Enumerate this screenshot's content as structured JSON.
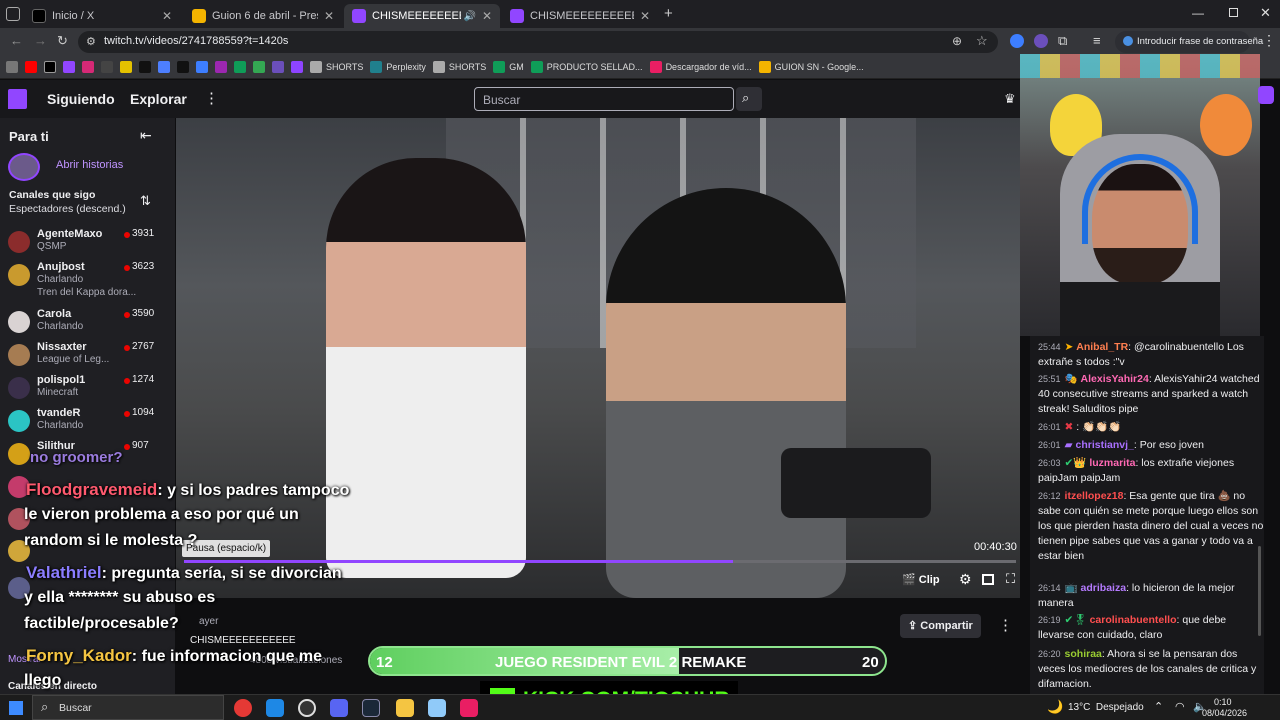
{
  "tabs": [
    {
      "label": "Inicio / X"
    },
    {
      "label": "Guion 6 de abril - Presentacion"
    },
    {
      "label": "CHISMEEEEEEEEEE - Twitch"
    },
    {
      "label": "CHISMEEEEEEEEEE - Twitch"
    }
  ],
  "address": {
    "url": "twitch.tv/videos/2741788559?t=1420s",
    "password_hint": "Introducir frase de contraseña"
  },
  "bookmarks": [
    "SHORTS",
    "Perplexity",
    "SHORTS",
    "GM",
    "PRODUCTO SELLAD...",
    "Descargador de víd...",
    "GUION SN - Google..."
  ],
  "nav": {
    "following": "Siguiendo",
    "explore": "Explorar",
    "search_placeholder": "Buscar"
  },
  "sidebar": {
    "for_you": "Para ti",
    "open_stories": "Abrir historias",
    "followed_title": "Canales que sigo",
    "sort": "Espectadores (descend.)",
    "channels": [
      {
        "name": "AgenteMaxo",
        "game": "QSMP",
        "viewers": "3931"
      },
      {
        "name": "Anujbost",
        "game": "Charlando",
        "extra": "Tren del Kappa dora...",
        "viewers": "3623"
      },
      {
        "name": "Carola",
        "game": "Charlando",
        "viewers": "3590"
      },
      {
        "name": "Nissaxter",
        "game": "League of Leg...",
        "viewers": "2767"
      },
      {
        "name": "polispol1",
        "game": "Minecraft",
        "viewers": "1274"
      },
      {
        "name": "tvandeR",
        "game": "Charlando",
        "viewers": "1094"
      },
      {
        "name": "Silithur",
        "game": "",
        "viewers": "907"
      }
    ],
    "show_more": "Mostrar",
    "live_channels": "Canales en directo"
  },
  "player": {
    "pause_tooltip": "Pausa (espacio/k)",
    "time": "00:40:30",
    "clip": "Clip",
    "share": "Compartir",
    "date": "ayer",
    "title": "CHISMEEEEEEEEEEE",
    "views": "4808 visualizaciones",
    "progress": 0.66
  },
  "overlay_chat": [
    {
      "user": "Floodgravemeid",
      "text": ": y si los padres tampoco"
    },
    {
      "user": "",
      "text": "le vieron problema a eso por qué un"
    },
    {
      "user": "",
      "text": "random si le molesta ?"
    },
    {
      "user": "Valathriel",
      "text": ": pregunta sería, si se divorcian"
    },
    {
      "user": "",
      "text": "y ella ******** su abuso es"
    },
    {
      "user": "",
      "text": "factible/procesable?"
    },
    {
      "user": "Forny_Kador",
      "text": ": fue informacion que me"
    },
    {
      "user": "",
      "text": "llego"
    }
  ],
  "overlay_top": "no groomer?",
  "goal": {
    "left": "12",
    "label": "JUEGO RESIDENT EVIL 2 REMAKE",
    "right": "20",
    "fill": 0.6
  },
  "kick": {
    "label": "KICK.COM/TIOSHUR"
  },
  "chat": [
    {
      "time": "25:44",
      "user": "Anibal_TR",
      "msg": ": @carolinabuentello Los extrañe s todos :\"v",
      "color": "#ff7f50"
    },
    {
      "time": "25:51",
      "user": "AlexisYahir24",
      "msg": ": AlexisYahir24 watched 40 consecutive streams and sparked a watch streak! Saluditos pipe",
      "color": "#ff69b4"
    },
    {
      "time": "26:01",
      "user": "",
      "msg": ": 👏🏻👏🏻👏🏻",
      "color": "#5b5bff"
    },
    {
      "time": "26:01",
      "user": "christianvj_",
      "msg": ": Por eso joven",
      "color": "#a970ff"
    },
    {
      "time": "26:03",
      "user": "luzmarita",
      "msg": ": los extrañe viejones paipJam paipJam",
      "color": "#ff69b4"
    },
    {
      "time": "26:12",
      "user": "itzellopez18",
      "msg": ": Esa gente que tira 💩 no sabe con quién se mete porque luego ellos son los que pierden hasta dinero del cual a veces no tienen pipe sabes que vas a ganar y todo va a estar bien",
      "color": "#ff4f4f"
    },
    {
      "time": "26:14",
      "user": "adribaiza",
      "msg": ": lo hicieron de la mejor manera",
      "color": "#b57bff"
    },
    {
      "time": "26:19",
      "user": "carolinabuentello",
      "msg": ": que debe llevarse con cuidado, claro",
      "color": "#ff4f4f"
    },
    {
      "time": "26:20",
      "user": "sohiraa",
      "msg": ": Ahora si se la pensaran dos veces los mediocres de los canales de critica y difamacion.",
      "color": "#9acd32"
    }
  ],
  "taskbar": {
    "search": "Buscar",
    "weather": "13°C  Despejado",
    "time": "0:10",
    "date": "08/04/2026"
  }
}
